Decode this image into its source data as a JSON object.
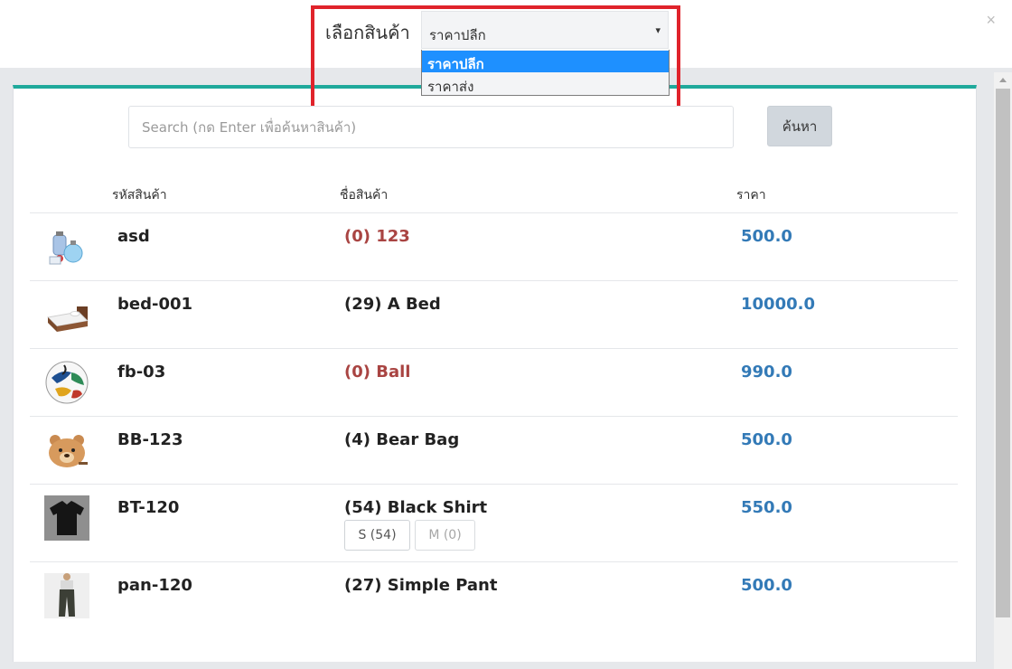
{
  "dialog": {
    "close_label": "×"
  },
  "selector": {
    "label": "เลือกสินค้า",
    "value": "ราคาปลีก",
    "arrow": "▾",
    "options": [
      "ราคาปลีก",
      "ราคาส่ง"
    ]
  },
  "search": {
    "placeholder": "Search (กด Enter เพื่อค้นหาสินค้า)",
    "button_label": "ค้นหา"
  },
  "table": {
    "headers": {
      "code": "รหัสสินค้า",
      "name": "ชื่อสินค้า",
      "price": "ราคา"
    },
    "rows": [
      {
        "code": "asd",
        "name": "(0) 123",
        "price": "500.0",
        "stock": 0,
        "icon": "perfume-bottles-thumbnail"
      },
      {
        "code": "bed-001",
        "name": "(29) A Bed",
        "price": "10000.0",
        "stock": 29,
        "icon": "bed-thumbnail"
      },
      {
        "code": "fb-03",
        "name": "(0) Ball",
        "price": "990.0",
        "stock": 0,
        "icon": "football-thumbnail"
      },
      {
        "code": "BB-123",
        "name": "(4) Bear Bag",
        "price": "500.0",
        "stock": 4,
        "icon": "bear-bag-thumbnail"
      },
      {
        "code": "BT-120",
        "name": "(54) Black Shirt",
        "price": "550.0",
        "stock": 54,
        "icon": "black-shirt-thumbnail",
        "variants": [
          {
            "label": "S (54)",
            "enabled": true
          },
          {
            "label": "M (0)",
            "enabled": false
          }
        ]
      },
      {
        "code": "pan-120",
        "name": "(27) Simple Pant",
        "price": "500.0",
        "stock": 27,
        "icon": "pants-thumbnail"
      }
    ]
  },
  "colors": {
    "accent_bar": "#1fa99b",
    "price": "#337ab7",
    "out_of_stock": "#a94442",
    "highlight_box": "#e0232b",
    "selected_option": "#1e90ff"
  }
}
